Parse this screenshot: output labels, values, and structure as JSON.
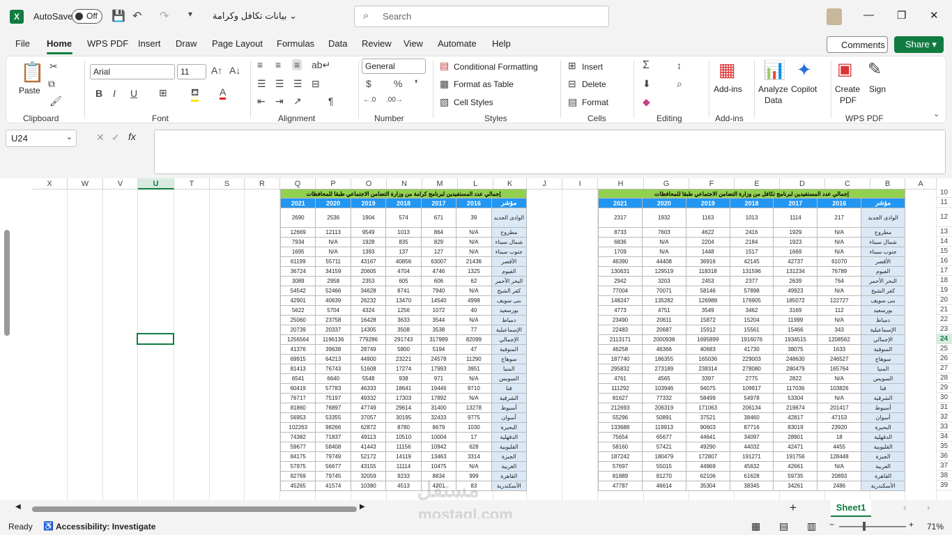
{
  "titlebar": {
    "autosave": "AutoSave",
    "toggle": "Off",
    "filename": "بيانات تكافل وكرامة",
    "search_placeholder": "Search"
  },
  "menu": [
    "File",
    "Home",
    "WPS PDF",
    "Insert",
    "Draw",
    "Page Layout",
    "Formulas",
    "Data",
    "Review",
    "View",
    "Automate",
    "Help"
  ],
  "buttons": {
    "comments": "Comments",
    "share": "Share"
  },
  "ribbon": {
    "clipboard": {
      "paste": "Paste",
      "label": "Clipboard"
    },
    "font": {
      "name": "Arial",
      "size": "11",
      "label": "Font",
      "bold": "B",
      "italic": "I",
      "underline": "U"
    },
    "alignment": {
      "label": "Alignment"
    },
    "number": {
      "format": "General",
      "label": "Number"
    },
    "styles": {
      "cond": "Conditional Formatting",
      "table": "Format as Table",
      "cell": "Cell Styles",
      "label": "Styles"
    },
    "cells": {
      "insert": "Insert",
      "delete": "Delete",
      "format": "Format",
      "label": "Cells"
    },
    "editing": {
      "label": "Editing"
    },
    "addins": {
      "btn": "Add-ins",
      "label": "Add-ins"
    },
    "analyze": {
      "l1": "Analyze",
      "l2": "Data"
    },
    "copilot": "Copilot",
    "wps": {
      "l1": "Create",
      "l2": "PDF",
      "sign": "Sign",
      "label": "WPS PDF"
    }
  },
  "namebox": "U24",
  "fx": "fx",
  "columns": [
    "X",
    "W",
    "V",
    "U",
    "T",
    "S",
    "R",
    "Q",
    "P",
    "O",
    "N",
    "M",
    "L",
    "K",
    "J",
    "I",
    "H",
    "G",
    "F",
    "E",
    "D",
    "C",
    "B",
    "A"
  ],
  "rows": [
    "10",
    "11",
    "12",
    "13",
    "14",
    "15",
    "16",
    "17",
    "18",
    "19",
    "20",
    "21",
    "22",
    "23",
    "24",
    "25",
    "26",
    "27",
    "28",
    "29",
    "30",
    "31",
    "32",
    "33",
    "34",
    "35",
    "36",
    "37",
    "38",
    "39"
  ],
  "left_table": {
    "title": "إجمالي عدد المستفيدين لبرنامج كرامة من وزارة التضامن الاجتماعي طبقا للمحافظات",
    "header": [
      "مؤشر",
      "2016",
      "2017",
      "2018",
      "2019",
      "2020",
      "2021"
    ],
    "rows": [
      [
        "الوادى الجديد",
        "39",
        "671",
        "574",
        "1904",
        "2536",
        "2690"
      ],
      [
        "مطروح",
        "N/A",
        "864",
        "1013",
        "9549",
        "12113",
        "12669"
      ],
      [
        "شمال سيناء",
        "N/A",
        "829",
        "835",
        "1928",
        "N/A",
        "7934"
      ],
      [
        "جنوب سيناء",
        "N/A",
        "127",
        "137",
        "1393",
        "N/A",
        "1695"
      ],
      [
        "الأقصر",
        "21436",
        "63007",
        "40856",
        "43167",
        "55711",
        "61199"
      ],
      [
        "الفيوم",
        "1325",
        "4746",
        "4704",
        "20605",
        "34159",
        "36724"
      ],
      [
        "البحر الأحمر",
        "62",
        "606",
        "605",
        "2353",
        "2958",
        "3089"
      ],
      [
        "كفر الشيخ",
        "N/A",
        "7940",
        "8741",
        "34628",
        "52466",
        "54542"
      ],
      [
        "بنى سويف",
        "4998",
        "14540",
        "13470",
        "26232",
        "40639",
        "42901"
      ],
      [
        "بورسعيد",
        "40",
        "1072",
        "1256",
        "4324",
        "5704",
        "5622"
      ],
      [
        "دمياط",
        "N/A",
        "3544",
        "3633",
        "16428",
        "23758",
        "25060"
      ],
      [
        "الإسماعيلية",
        "77",
        "3538",
        "3508",
        "14305",
        "20337",
        "20739"
      ],
      [
        "الإجمالي",
        "82099",
        "317989",
        "291743",
        "779286",
        "1196136",
        "1256564"
      ],
      [
        "المنوفية",
        "47",
        "5194",
        "5800",
        "28749",
        "39638",
        "41376"
      ],
      [
        "سوهاج",
        "11290",
        "24578",
        "23221",
        "44900",
        "64213",
        "69915"
      ],
      [
        "المنيا",
        "3951",
        "17993",
        "17274",
        "51608",
        "76743",
        "81413"
      ],
      [
        "السويس",
        "N/A",
        "971",
        "938",
        "5548",
        "6640",
        "6541"
      ],
      [
        "قنا",
        "9710",
        "19446",
        "18641",
        "46333",
        "57783",
        "60419"
      ],
      [
        "الشرقية",
        "N/A",
        "17892",
        "17303",
        "49332",
        "75197",
        "76717"
      ],
      [
        "أسيوط",
        "13278",
        "31400",
        "29614",
        "47749",
        "76897",
        "81860"
      ],
      [
        "أسوان",
        "9775",
        "32433",
        "30195",
        "37057",
        "53355",
        "56953"
      ],
      [
        "البحيرة",
        "1030",
        "8679",
        "8780",
        "62872",
        "98266",
        "102263"
      ],
      [
        "الدقهلية",
        "17",
        "10004",
        "10510",
        "49113",
        "71837",
        "74382"
      ],
      [
        "القليوبية",
        "628",
        "10942",
        "11156",
        "41443",
        "58408",
        "59677"
      ],
      [
        "الجيزة",
        "3314",
        "13463",
        "14119",
        "52172",
        "79749",
        "84175"
      ],
      [
        "الغربية",
        "N/A",
        "10475",
        "11114",
        "43155",
        "56677",
        "57975"
      ],
      [
        "القاهرة",
        "999",
        "8834",
        "9233",
        "32059",
        "79745",
        "82769"
      ],
      [
        "الأسكندرية",
        "83",
        "4201",
        "4513",
        "10380",
        "41574",
        "45265"
      ]
    ]
  },
  "right_table": {
    "title": "إجمالي عدد المستفيدين لبرنامج تكافل من وزارة التضامن الاجتماعي طبقا للمحافظات",
    "header": [
      "مؤشر",
      "2016",
      "2017",
      "2018",
      "2019",
      "2020",
      "2021"
    ],
    "rows": [
      [
        "الوادى الجديد",
        "217",
        "1114",
        "1013",
        "1163",
        "1932",
        "2317"
      ],
      [
        "مطروح",
        "N/A",
        "1929",
        "2416",
        "4622",
        "7603",
        "8733"
      ],
      [
        "شمال سيناء",
        "N/A",
        "1923",
        "2184",
        "2204",
        "N/A",
        "6836"
      ],
      [
        "جنوب سيناء",
        "N/A",
        "1669",
        "1517",
        "1448",
        "N/A",
        "1709"
      ],
      [
        "الأقصر",
        "61070",
        "42737",
        "42145",
        "36916",
        "44408",
        "46390"
      ],
      [
        "الفيوم",
        "76789",
        "131234",
        "131596",
        "118318",
        "129519",
        "130631"
      ],
      [
        "البحر الأحمر",
        "764",
        "2639",
        "2377",
        "2453",
        "3203",
        "2942"
      ],
      [
        "كفر الشيخ",
        "N/A",
        "49923",
        "57898",
        "58146",
        "70071",
        "77004"
      ],
      [
        "بنى سويف",
        "122727",
        "185072",
        "176905",
        "126988",
        "135282",
        "148247"
      ],
      [
        "بورسعيد",
        "112",
        "3169",
        "3462",
        "3549",
        "4751",
        "4773"
      ],
      [
        "دمياط",
        "N/A",
        "11999",
        "15204",
        "15872",
        "20611",
        "23490"
      ],
      [
        "الإسماعيلية",
        "343",
        "15466",
        "15561",
        "15912",
        "20687",
        "22483"
      ],
      [
        "الإجمالي",
        "1208562",
        "1934515",
        "1916076",
        "1695899",
        "2000938",
        "2113171"
      ],
      [
        "المنوفية",
        "1633",
        "38075",
        "41730",
        "40683",
        "46366",
        "46258"
      ],
      [
        "سوهاج",
        "246527",
        "248630",
        "229003",
        "165036",
        "186355",
        "187740"
      ],
      [
        "المنيا",
        "165764",
        "280479",
        "278080",
        "238314",
        "273189",
        "295832"
      ],
      [
        "السويس",
        "N/A",
        "2822",
        "2775",
        "3397",
        "4565",
        "4761"
      ],
      [
        "قنا",
        "103826",
        "117036",
        "109917",
        "94075",
        "103946",
        "111292"
      ],
      [
        "الشرقية",
        "N/A",
        "53304",
        "54978",
        "58499",
        "77332",
        "81627"
      ],
      [
        "أسيوط",
        "201417",
        "219674",
        "206134",
        "171063",
        "206319",
        "212693"
      ],
      [
        "أسوان",
        "47153",
        "42817",
        "38460",
        "37521",
        "50891",
        "55296"
      ],
      [
        "البحيرة",
        "23920",
        "83019",
        "87716",
        "90603",
        "119913",
        "133688"
      ],
      [
        "الدقهلية",
        "18",
        "28901",
        "34097",
        "44641",
        "65677",
        "75654"
      ],
      [
        "القليوبية",
        "4455",
        "42471",
        "44032",
        "49290",
        "57421",
        "58160"
      ],
      [
        "الجيزة",
        "128448",
        "191756",
        "191271",
        "172807",
        "180479",
        "187242"
      ],
      [
        "الغربية",
        "N/A",
        "42661",
        "45632",
        "44969",
        "55015",
        "57697"
      ],
      [
        "القاهرة",
        "20893",
        "59735",
        "61628",
        "62106",
        "81270",
        "81889"
      ],
      [
        "الأسكندرية",
        "2486",
        "34261",
        "38345",
        "35304",
        "46614",
        "47787"
      ]
    ]
  },
  "sheet_tab": "Sheet1",
  "status": {
    "ready": "Ready",
    "accessibility": "Accessibility: Investigate",
    "zoom": "71%"
  },
  "watermark": {
    "ar": "مستقل",
    "en": "mostaql.com"
  }
}
